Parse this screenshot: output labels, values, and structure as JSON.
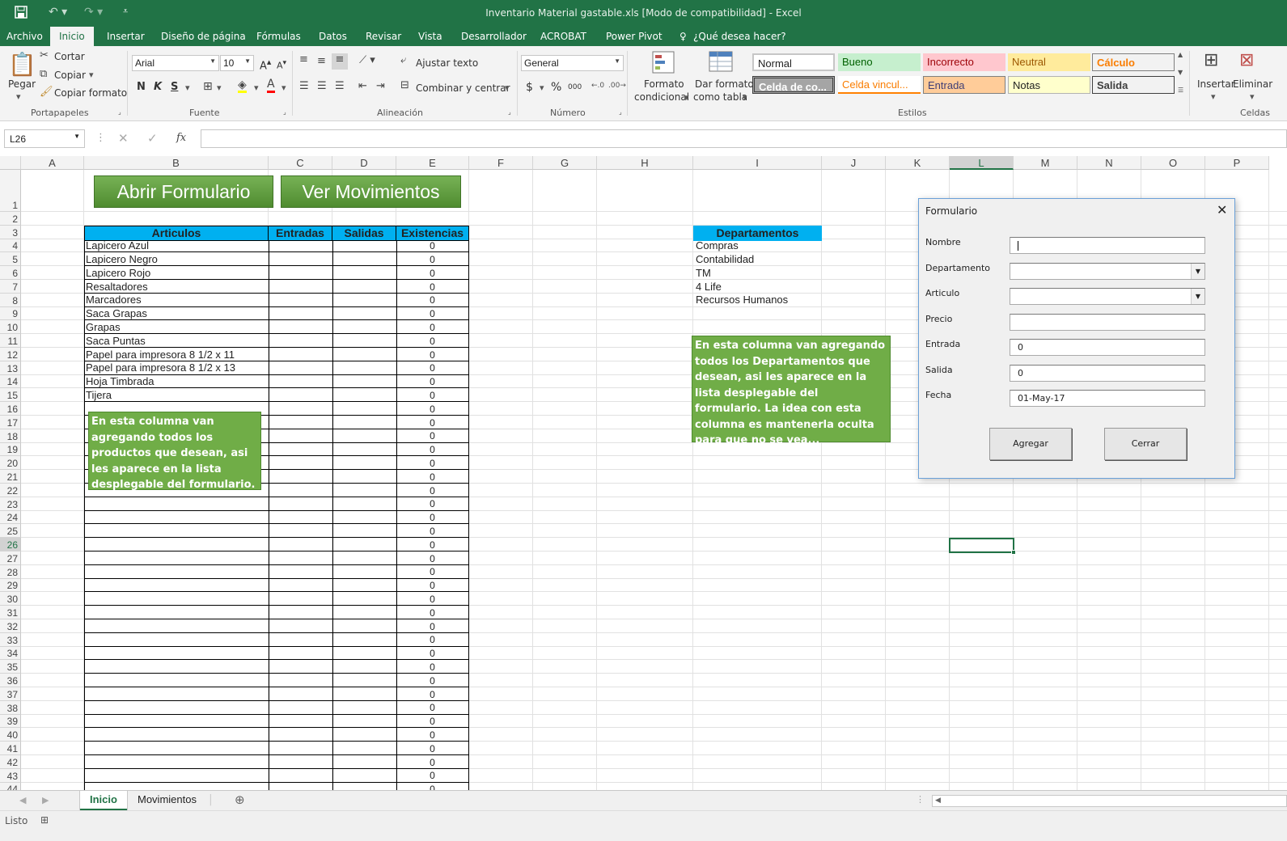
{
  "window": {
    "title": "Inventario Material gastable.xls  [Modo de compatibilidad] - Excel"
  },
  "quick_access": {
    "save_icon": "save-icon",
    "undo_icon": "undo-icon",
    "redo_icon": "redo-icon",
    "customize_icon": "customize-icon"
  },
  "menu": {
    "items": [
      "Archivo",
      "Inicio",
      "Insertar",
      "Diseño de página",
      "Fórmulas",
      "Datos",
      "Revisar",
      "Vista",
      "Desarrollador",
      "ACROBAT",
      "Power Pivot"
    ],
    "active": "Inicio",
    "tell_me": "¿Qué desea hacer?"
  },
  "ribbon": {
    "clipboard": {
      "paste": "Pegar",
      "cut": "Cortar",
      "copy": "Copiar",
      "format_painter": "Copiar formato",
      "group": "Portapapeles"
    },
    "font": {
      "name": "Arial",
      "size": "10",
      "bold": "N",
      "italic": "K",
      "underline": "S",
      "group": "Fuente"
    },
    "alignment": {
      "wrap": "Ajustar texto",
      "merge": "Combinar y centrar",
      "group": "Alineación"
    },
    "number": {
      "format": "General",
      "currency": "$",
      "percent": "%",
      "thousands": "000",
      "group": "Número"
    },
    "styles": {
      "conditional_l1": "Formato",
      "conditional_l2": "condicional",
      "table_l1": "Dar formato",
      "table_l2": "como tabla",
      "cells": [
        "Normal",
        "Bueno",
        "Incorrecto",
        "Neutral",
        "Cálculo",
        "Celda de co...",
        "Celda vincul...",
        "Entrada",
        "Notas",
        "Salida"
      ],
      "group": "Estilos"
    },
    "cells": {
      "insert": "Insertar",
      "delete": "Eliminar",
      "group": "Celdas"
    }
  },
  "formula_bar": {
    "name_box": "L26",
    "fx": "fx",
    "content": ""
  },
  "columns": [
    "A",
    "B",
    "C",
    "D",
    "E",
    "F",
    "G",
    "H",
    "I",
    "J",
    "K",
    "L",
    "M",
    "N",
    "O",
    "P"
  ],
  "selected_column": "L",
  "selected_row": "26",
  "rows": [
    "1",
    "2",
    "3",
    "4",
    "5",
    "6",
    "7",
    "8",
    "9",
    "10",
    "11",
    "12",
    "13",
    "14",
    "15",
    "16",
    "17",
    "18",
    "19",
    "20",
    "21",
    "22",
    "23",
    "24",
    "25",
    "26",
    "27",
    "28",
    "29",
    "30",
    "31",
    "32",
    "33",
    "34",
    "35",
    "36",
    "37",
    "38",
    "39",
    "40",
    "41",
    "42",
    "43",
    "44"
  ],
  "buttons": {
    "open_form": "Abrir Formulario",
    "view_movements": "Ver Movimientos"
  },
  "inventory": {
    "headers": [
      "Articulos",
      "Entradas",
      "Salidas",
      "Existencias"
    ],
    "items": [
      "Lapicero Azul",
      "Lapicero Negro",
      "Lapicero Rojo",
      "Resaltadores",
      "Marcadores",
      "Saca Grapas",
      "Grapas",
      "Saca Puntas",
      "Papel para impresora 8 1/2 x 11",
      "Papel para impresora 8 1/2 x 13",
      "Hoja Timbrada",
      "Tijera"
    ],
    "existencias": [
      "0",
      "0",
      "0",
      "0",
      "0",
      "0",
      "0",
      "0",
      "0",
      "0",
      "0",
      "0",
      "0",
      "0",
      "0",
      "0",
      "0",
      "0",
      "0",
      "0",
      "0",
      "0",
      "0",
      "0",
      "0",
      "0",
      "0",
      "0",
      "0",
      "0",
      "0",
      "0",
      "0",
      "0",
      "0",
      "0",
      "0",
      "0",
      "0",
      "0",
      "0"
    ]
  },
  "departments": {
    "header": "Departamentos",
    "items": [
      "Compras",
      "Contabilidad",
      "TM",
      "4 Life",
      "Recursos Humanos"
    ]
  },
  "notes": {
    "products": "En esta columna van agregando todos los productos que desean, asi les aparece en la lista desplegable del formulario.",
    "departments": "En esta columna van agregando todos los Departamentos que desean, asi les aparece en la lista desplegable del formulario. La idea con esta columna es mantenerla oculta para que no se vea..."
  },
  "dialog": {
    "title": "Formulario",
    "labels": {
      "nombre": "Nombre",
      "departamento": "Departamento",
      "articulo": "Articulo",
      "precio": "Precio",
      "entrada": "Entrada",
      "salida": "Salida",
      "fecha": "Fecha"
    },
    "values": {
      "nombre": "",
      "departamento": "",
      "articulo": "",
      "precio": "",
      "entrada": "0",
      "salida": "0",
      "fecha": "01-May-17"
    },
    "add_button": "Agregar",
    "close_button": "Cerrar"
  },
  "sheets": {
    "tabs": [
      "Inicio",
      "Movimientos"
    ],
    "active": "Inicio"
  },
  "status": {
    "text": "Listo"
  },
  "colors": {
    "excel_green": "#217346",
    "header_blue": "#00b0f0",
    "note_green": "#70ad47"
  }
}
